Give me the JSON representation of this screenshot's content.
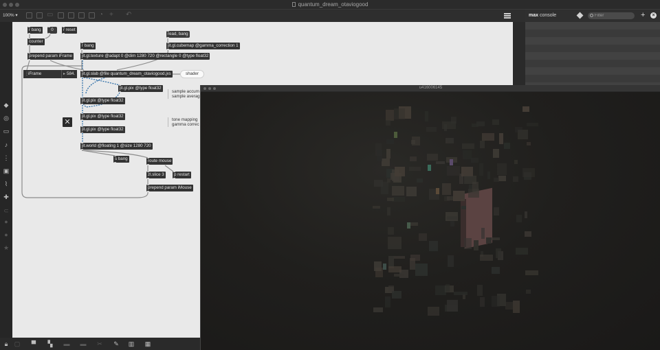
{
  "window": {
    "title": "quantum_dream_otaviogood"
  },
  "toolbar": {
    "zoom": "100%"
  },
  "console": {
    "title_bold": "max",
    "title_rest": " console",
    "filter_placeholder": "Filter",
    "add": "+",
    "close": "×"
  },
  "patch": {
    "r_bang_1": "r bang",
    "zero_msg": "0",
    "r_reset": "r reset",
    "counter": "counter",
    "prepend_iframe": "prepend param iFrame",
    "iframe_label": "iFrame",
    "iframe_value": "584.",
    "r_bang_2": "r bang",
    "read_bang": "read, bang",
    "cubemap": "jit.gl.cubemap @gamma_correction 1",
    "texture": "jit.gl.texture @adapt 0 @dim 1280 720 @rectangle 0 @type float32",
    "slab": "jit.gl.slab @file quantum_dream_otaviogood.jxs",
    "shader_bubble": "shader",
    "pix_1": "jit.gl.pix @type float32",
    "pix_2": "jit.gl.pix @type float32",
    "pix_3": "jit.gl.pix @type float32",
    "pix_4": "jit.gl.pix @type float32",
    "sample_note_1": "sample accum",
    "sample_note_2": "sample averag",
    "tone_note_1": "tone mapping",
    "tone_note_2": "gamma correc",
    "world": "jit.world @floating 1 @size 1280 720",
    "s_bang": "s bang",
    "route_mouse": "route mouse",
    "zl_slice": "zl.slice 3",
    "p_restart": "p restart",
    "prepend_imouse": "prepend param iMouse"
  },
  "render_window": {
    "title": "u416006145"
  },
  "colors": {
    "canvas": "#e9e9e9",
    "object": "#333333",
    "chrome": "#2e2e2e",
    "console_bg": "#3d3d3d",
    "patch_cord": "#2f6fa8"
  }
}
